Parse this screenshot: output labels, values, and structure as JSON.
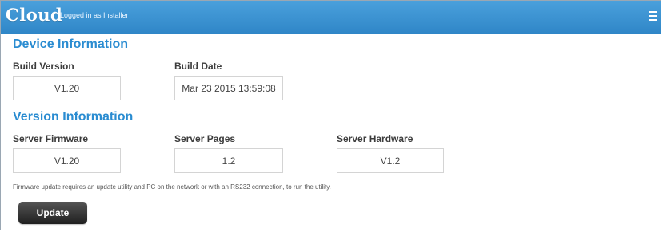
{
  "header": {
    "logo": "Cloud",
    "logged_in": "Logged in as Installer",
    "menu_icon": "hamburger-menu-icon"
  },
  "device_information": {
    "title": "Device Information",
    "build_version_label": "Build Version",
    "build_version": "V1.20",
    "build_date_label": "Build Date",
    "build_date": "Mar 23 2015 13:59:08"
  },
  "version_information": {
    "title": "Version Information",
    "server_firmware_label": "Server Firmware",
    "server_firmware": "V1.20",
    "server_pages_label": "Server Pages",
    "server_pages": "1.2",
    "server_hardware_label": "Server Hardware",
    "server_hardware": "V1.2"
  },
  "note": "Firmware update requires an update utility and PC on the network or with an RS232 connection, to run the utility.",
  "actions": {
    "update_label": "Update"
  }
}
